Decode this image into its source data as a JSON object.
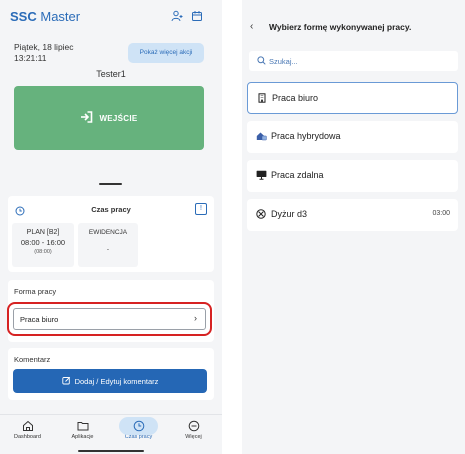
{
  "left": {
    "app_title_bold": "SSC",
    "app_title_rest": "Master",
    "date": "Piątek, 18 lipiec",
    "time": "13:21:11",
    "more_actions": "Pokaż więcej akcji",
    "user": "Tester1",
    "entry_button": "WEJŚCIE",
    "work_time": {
      "title": "Czas pracy",
      "plan_label": "PLAN [B2]",
      "plan_hours": "08:00 - 16:00",
      "plan_duration": "(08:00)",
      "evidence_label": "EWIDENCJA",
      "evidence_value": "-"
    },
    "work_form": {
      "title": "Forma pracy",
      "selected": "Praca biuro",
      "chevron": "›"
    },
    "comment": {
      "title": "Komentarz",
      "button": "Dodaj / Edytuj komentarz"
    },
    "nav": [
      {
        "label": "Dashboard",
        "icon": "home-icon"
      },
      {
        "label": "Aplikacje",
        "icon": "folder-icon"
      },
      {
        "label": "Czas pracy",
        "icon": "clock-icon",
        "active": true
      },
      {
        "label": "Więcej",
        "icon": "more-icon"
      }
    ],
    "colors": {
      "accent": "#2b6cb8",
      "entry": "#66b27d",
      "highlight": "#d62222",
      "button": "#2567b5"
    }
  },
  "right": {
    "back": "‹",
    "title": "Wybierz formę wykonywanej pracy.",
    "search_placeholder": "Szukaj...",
    "options": [
      {
        "label": "Praca biuro",
        "icon": "building-icon",
        "selected": true
      },
      {
        "label": "Praca hybrydowa",
        "icon": "hybrid-icon"
      },
      {
        "label": "Praca zdalna",
        "icon": "monitor-icon"
      },
      {
        "label": "Dyżur d3",
        "icon": "duty-icon",
        "duration": "03:00"
      }
    ]
  }
}
